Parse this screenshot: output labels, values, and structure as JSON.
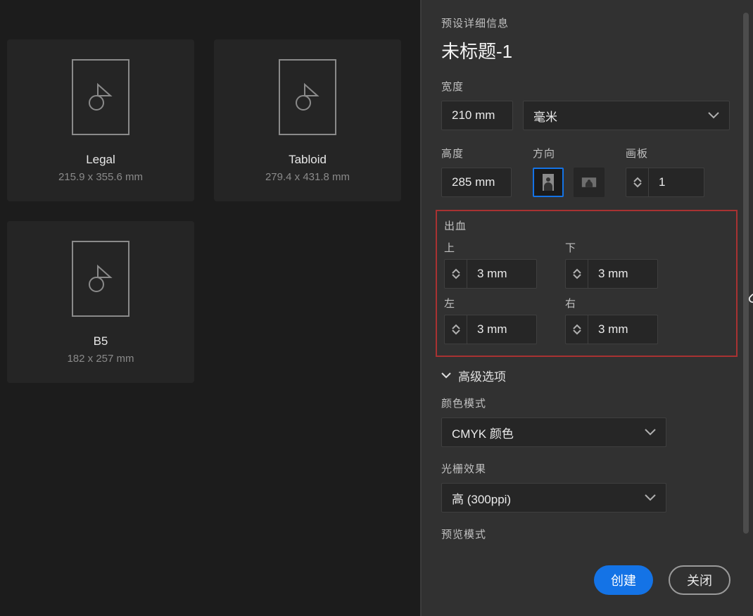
{
  "presets": [
    {
      "name": "Legal",
      "dims": "215.9 x 355.6 mm"
    },
    {
      "name": "Tabloid",
      "dims": "279.4 x 431.8 mm"
    },
    {
      "name": "B5",
      "dims": "182 x 257 mm"
    }
  ],
  "details": {
    "section_title": "预设详细信息",
    "doc_title": "未标题-1",
    "width_label": "宽度",
    "width_value": "210 mm",
    "unit_select": "毫米",
    "height_label": "高度",
    "height_value": "285 mm",
    "orient_label": "方向",
    "artboard_label": "画板",
    "artboard_count": "1",
    "bleed": {
      "title": "出血",
      "top_label": "上",
      "top_value": "3 mm",
      "bottom_label": "下",
      "bottom_value": "3 mm",
      "left_label": "左",
      "left_value": "3 mm",
      "right_label": "右",
      "right_value": "3 mm"
    },
    "advanced_label": "高级选项",
    "color_mode_label": "颜色模式",
    "color_mode_value": "CMYK 颜色",
    "raster_label": "光栅效果",
    "raster_value": "高 (300ppi)",
    "preview_label": "预览模式"
  },
  "actions": {
    "create": "创建",
    "close": "关闭"
  }
}
